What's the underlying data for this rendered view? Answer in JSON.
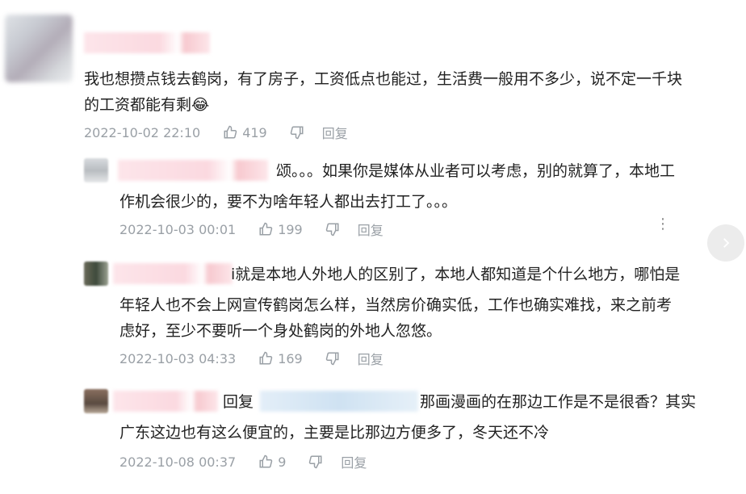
{
  "comments": [
    {
      "lines": [
        "我也想攒点钱去鹤岗，有了房子，工资低点也能过，生活费一般用不多少，说不定一千块",
        "的工资都能有剩😂"
      ],
      "time": "2022-10-02 22:10",
      "likes": "419",
      "reply_label": "回复"
    },
    {
      "lines": [
        "颂。。。如果你是媒体从业者可以考虑，别的就算了，本地工",
        "作机会很少的，要不为啥年轻人都出去打工了。。。"
      ],
      "time": "2022-10-03 00:01",
      "likes": "199",
      "reply_label": "回复"
    },
    {
      "lines": [
        "i就是本地人外地人的区别了，本地人都知道是个什么地方，哪怕是",
        "年轻人也不会上网宣传鹤岗怎么样，当然房价确实低，工作也确实难找，来之前考",
        "虑好，至少不要听一个身处鹤岗的外地人忽悠。"
      ],
      "time": "2022-10-03 04:33",
      "likes": "169",
      "reply_label": "回复"
    },
    {
      "prefix": "回复",
      "lines": [
        "那画漫画的在那边工作是不是很香？其实",
        "广东这边也有这么便宜的，主要是比那边方便多了，冬天还不冷"
      ],
      "time": "2022-10-08 00:37",
      "likes": "9",
      "reply_label": "回复"
    }
  ],
  "icons": {
    "like": "thumbs-up-icon",
    "dislike": "thumbs-down-icon",
    "more": "more-vertical-icon",
    "next": "chevron-right-icon"
  }
}
